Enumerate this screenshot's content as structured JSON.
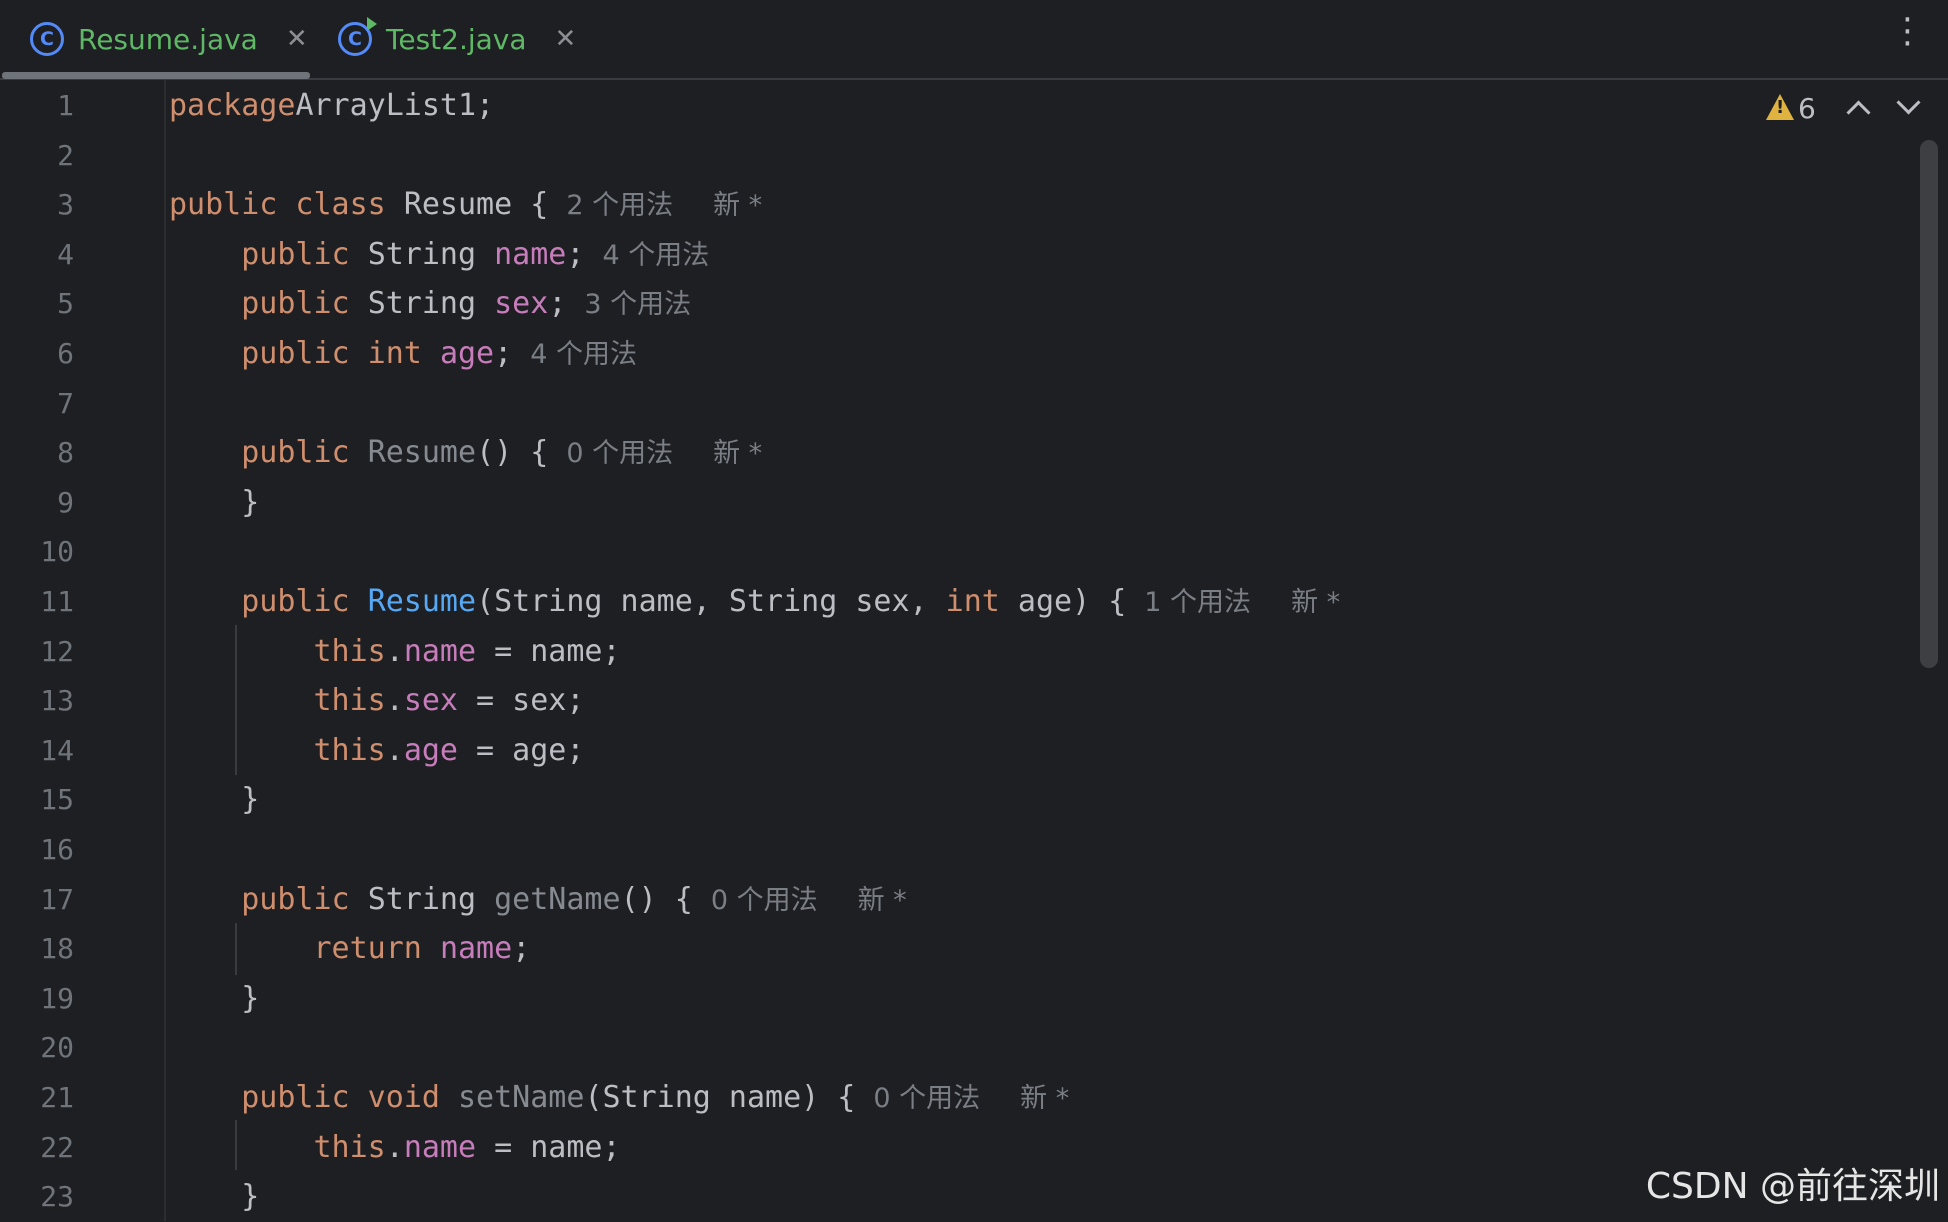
{
  "tabs": [
    {
      "label": "Resume.java",
      "icon": "class-icon",
      "active": true
    },
    {
      "label": "Test2.java",
      "icon": "runnable-class-icon",
      "active": false
    }
  ],
  "inspections": {
    "warning_count": "6"
  },
  "hints": {
    "new": "新 *"
  },
  "editor": {
    "line_numbers": [
      "1",
      "2",
      "3",
      "4",
      "5",
      "6",
      "7",
      "8",
      "9",
      "10",
      "11",
      "12",
      "13",
      "14",
      "15",
      "16",
      "17",
      "18",
      "19",
      "20",
      "21",
      "22",
      "23"
    ],
    "lines": [
      {
        "n": "1",
        "parts": [
          [
            "kw",
            "package"
          ],
          [
            "",
            "ArrayList1;"
          ]
        ]
      },
      {
        "n": "2",
        "parts": []
      },
      {
        "n": "3",
        "parts": [
          [
            "kw",
            "public class "
          ],
          [
            "",
            "Resume {"
          ]
        ],
        "usage": "2 个用法",
        "new": true
      },
      {
        "n": "4",
        "parts": [
          [
            "",
            "    "
          ],
          [
            "kw",
            "public "
          ],
          [
            "",
            "String "
          ],
          [
            "fld",
            "name"
          ],
          [
            "",
            ";"
          ]
        ],
        "usage": "4 个用法"
      },
      {
        "n": "5",
        "parts": [
          [
            "",
            "    "
          ],
          [
            "kw",
            "public "
          ],
          [
            "",
            "String "
          ],
          [
            "fld",
            "sex"
          ],
          [
            "",
            ";"
          ]
        ],
        "usage": "3 个用法"
      },
      {
        "n": "6",
        "parts": [
          [
            "",
            "    "
          ],
          [
            "kw",
            "public int "
          ],
          [
            "fld",
            "age"
          ],
          [
            "",
            ";"
          ]
        ],
        "usage": "4 个用法"
      },
      {
        "n": "7",
        "parts": []
      },
      {
        "n": "8",
        "parts": [
          [
            "",
            "    "
          ],
          [
            "kw",
            "public "
          ],
          [
            "unused",
            "Resume"
          ],
          [
            "",
            "() {"
          ]
        ],
        "usage": "0 个用法",
        "new": true
      },
      {
        "n": "9",
        "parts": [
          [
            "",
            "    }"
          ]
        ]
      },
      {
        "n": "10",
        "parts": []
      },
      {
        "n": "11",
        "parts": [
          [
            "",
            "    "
          ],
          [
            "kw",
            "public "
          ],
          [
            "mth",
            "Resume"
          ],
          [
            "",
            "(String name, String sex, "
          ],
          [
            "kw",
            "int "
          ],
          [
            "",
            "age) {"
          ]
        ],
        "usage": "1 个用法",
        "new": true
      },
      {
        "n": "12",
        "parts": [
          [
            "",
            "        "
          ],
          [
            "kw",
            "this"
          ],
          [
            "",
            "."
          ],
          [
            "fld",
            "name"
          ],
          [
            "",
            " = name;"
          ]
        ]
      },
      {
        "n": "13",
        "parts": [
          [
            "",
            "        "
          ],
          [
            "kw",
            "this"
          ],
          [
            "",
            "."
          ],
          [
            "fld",
            "sex"
          ],
          [
            "",
            " = sex;"
          ]
        ]
      },
      {
        "n": "14",
        "parts": [
          [
            "",
            "        "
          ],
          [
            "kw",
            "this"
          ],
          [
            "",
            "."
          ],
          [
            "fld",
            "age"
          ],
          [
            "",
            " = age;"
          ]
        ]
      },
      {
        "n": "15",
        "parts": [
          [
            "",
            "    }"
          ]
        ]
      },
      {
        "n": "16",
        "parts": []
      },
      {
        "n": "17",
        "parts": [
          [
            "",
            "    "
          ],
          [
            "kw",
            "public "
          ],
          [
            "",
            "String "
          ],
          [
            "unused",
            "getName"
          ],
          [
            "",
            "() {"
          ]
        ],
        "usage": "0 个用法",
        "new": true
      },
      {
        "n": "18",
        "parts": [
          [
            "",
            "        "
          ],
          [
            "kw",
            "return "
          ],
          [
            "fld",
            "name"
          ],
          [
            "",
            ";"
          ]
        ]
      },
      {
        "n": "19",
        "parts": [
          [
            "",
            "    }"
          ]
        ]
      },
      {
        "n": "20",
        "parts": []
      },
      {
        "n": "21",
        "parts": [
          [
            "",
            "    "
          ],
          [
            "kw",
            "public void "
          ],
          [
            "unused",
            "setName"
          ],
          [
            "",
            "(String name) {"
          ]
        ],
        "usage": "0 个用法",
        "new": true
      },
      {
        "n": "22",
        "parts": [
          [
            "",
            "        "
          ],
          [
            "kw",
            "this"
          ],
          [
            "",
            "."
          ],
          [
            "fld",
            "name"
          ],
          [
            "",
            " = name;"
          ]
        ]
      },
      {
        "n": "23",
        "parts": [
          [
            "",
            "    }"
          ]
        ]
      }
    ]
  },
  "watermark": "CSDN @前往深圳"
}
